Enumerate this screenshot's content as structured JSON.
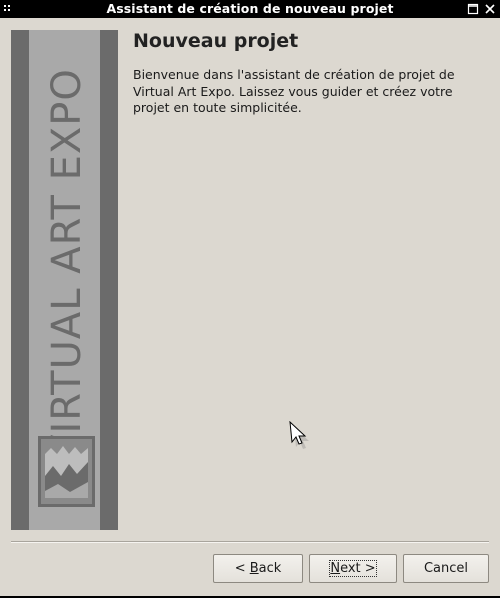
{
  "window": {
    "title": "Assistant de création de nouveau projet"
  },
  "banner": {
    "text": "VIRTUAL ART EXPO",
    "logo_icon": "virtual-art-expo-logo"
  },
  "content": {
    "heading": "Nouveau projet",
    "description": "Bienvenue dans l'assistant de création de projet de Virtual Art Expo. Laissez vous guider et créez votre projet en toute simplicitée."
  },
  "buttons": {
    "back": {
      "prefix": "< ",
      "mnemonic": "B",
      "rest": "ack"
    },
    "next": {
      "mnemonic": "N",
      "rest": "ext >"
    },
    "cancel": "Cancel"
  },
  "colors": {
    "titlebar_bg": "#000000",
    "window_bg": "#dcd8d0",
    "banner_dark": "#6b6b6b",
    "banner_light": "#a9a9a9"
  }
}
